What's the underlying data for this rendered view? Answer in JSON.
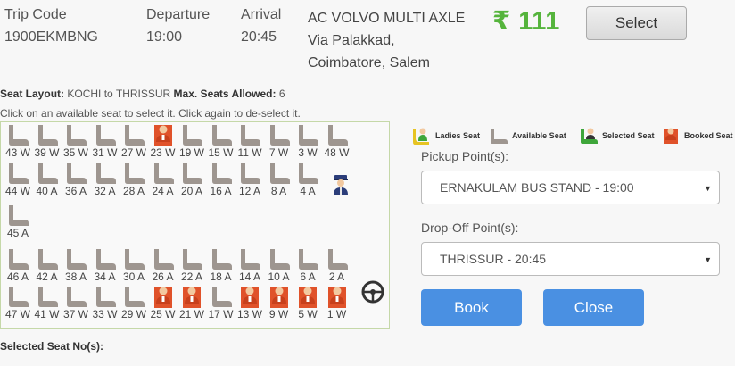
{
  "header": {
    "trip_code_label": "Trip Code",
    "trip_code": "1900EKMBNG",
    "departure_label": "Departure",
    "departure": "19:00",
    "arrival_label": "Arrival",
    "arrival": "20:45",
    "bus_name": "AC VOLVO MULTI AXLE",
    "route_line1": "Via Palakkad,",
    "route_line2": "Coimbatore, Salem",
    "price": "₹ 111",
    "select_label": "Select"
  },
  "layout_info": {
    "seat_layout_label": "Seat Layout:",
    "from": "KOCHI",
    "to_word": "to",
    "to": "THRISSUR",
    "max_label": "Max. Seats Allowed:",
    "max_value": "6",
    "hint": "Click on an available seat to select it. Click again to de-select it."
  },
  "legend": {
    "ladies": "Ladies Seat",
    "available": "Available Seat",
    "selected": "Selected Seat",
    "booked": "Booked Seat"
  },
  "colors": {
    "available": "#9e9690",
    "booked": "#e0522a",
    "ladies": "#e7c422",
    "selected": "#3ea63a",
    "price": "#55b43c",
    "button": "#4a90e2"
  },
  "seat_rows": [
    [
      {
        "label": "43 W",
        "status": "available"
      },
      {
        "label": "39 W",
        "status": "available"
      },
      {
        "label": "35 W",
        "status": "available"
      },
      {
        "label": "31 W",
        "status": "available"
      },
      {
        "label": "27 W",
        "status": "available"
      },
      {
        "label": "23 W",
        "status": "booked"
      },
      {
        "label": "19 W",
        "status": "available"
      },
      {
        "label": "15 W",
        "status": "available"
      },
      {
        "label": "11 W",
        "status": "available"
      },
      {
        "label": "7 W",
        "status": "available"
      },
      {
        "label": "3 W",
        "status": "available"
      },
      {
        "label": "48 W",
        "status": "available"
      }
    ],
    [
      {
        "label": "44 W",
        "status": "available"
      },
      {
        "label": "40 A",
        "status": "available"
      },
      {
        "label": "36 A",
        "status": "available"
      },
      {
        "label": "32 A",
        "status": "available"
      },
      {
        "label": "28 A",
        "status": "available"
      },
      {
        "label": "24 A",
        "status": "available"
      },
      {
        "label": "20 A",
        "status": "available"
      },
      {
        "label": "16 A",
        "status": "available"
      },
      {
        "label": "12 A",
        "status": "available"
      },
      {
        "label": "8 A",
        "status": "available"
      },
      {
        "label": "4 A",
        "status": "available"
      }
    ],
    [
      {
        "label": "45 A",
        "status": "available"
      }
    ],
    [
      {
        "label": "46 A",
        "status": "available"
      },
      {
        "label": "42 A",
        "status": "available"
      },
      {
        "label": "38 A",
        "status": "available"
      },
      {
        "label": "34 A",
        "status": "available"
      },
      {
        "label": "30 A",
        "status": "available"
      },
      {
        "label": "26 A",
        "status": "available"
      },
      {
        "label": "22 A",
        "status": "available"
      },
      {
        "label": "18 A",
        "status": "available"
      },
      {
        "label": "14 A",
        "status": "available"
      },
      {
        "label": "10 A",
        "status": "available"
      },
      {
        "label": "6 A",
        "status": "available"
      },
      {
        "label": "2 A",
        "status": "available"
      }
    ],
    [
      {
        "label": "47 W",
        "status": "available"
      },
      {
        "label": "41 W",
        "status": "available"
      },
      {
        "label": "37 W",
        "status": "available"
      },
      {
        "label": "33 W",
        "status": "available"
      },
      {
        "label": "29 W",
        "status": "available"
      },
      {
        "label": "25 W",
        "status": "booked"
      },
      {
        "label": "21 W",
        "status": "booked"
      },
      {
        "label": "17 W",
        "status": "available"
      },
      {
        "label": "13 W",
        "status": "booked"
      },
      {
        "label": "9 W",
        "status": "booked"
      },
      {
        "label": "5 W",
        "status": "booked"
      },
      {
        "label": "1 W",
        "status": "booked"
      }
    ]
  ],
  "pickup": {
    "label": "Pickup Point(s):",
    "value": "ERNAKULAM BUS STAND - 19:00"
  },
  "dropoff": {
    "label": "Drop-Off Point(s):",
    "value": "THRISSUR - 20:45"
  },
  "actions": {
    "book": "Book",
    "close": "Close"
  },
  "selected_seats_label": "Selected Seat No(s):"
}
